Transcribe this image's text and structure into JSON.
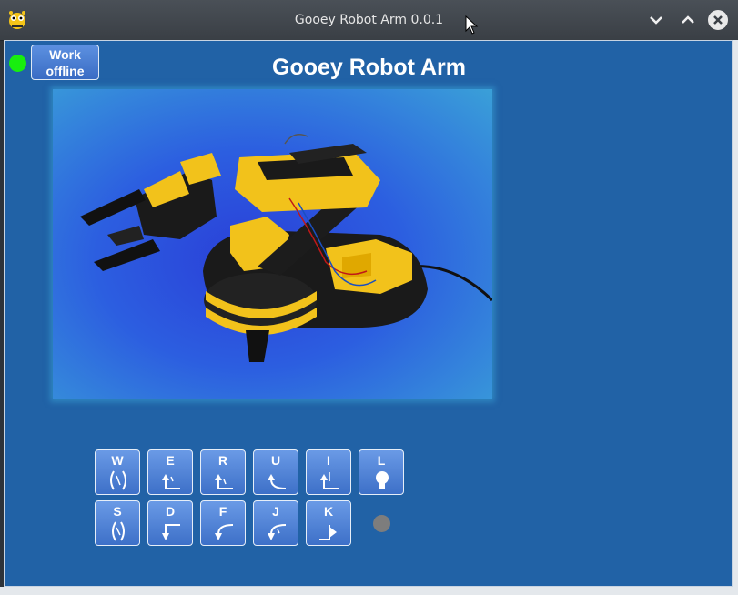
{
  "window": {
    "title": "Gooey Robot Arm 0.0.1",
    "icon": "pygame-snake-icon",
    "controls": [
      "minimize-icon",
      "maximize-icon",
      "close-icon"
    ]
  },
  "app": {
    "heading": "Gooey Robot Arm",
    "connection_status_color": "#18ee0f",
    "offline_button_label": "Work\noffline",
    "photo_description_icon": "robot-arm-photo"
  },
  "keys": {
    "row1": [
      {
        "letter": "W",
        "icon": "gripper-open-icon"
      },
      {
        "letter": "E",
        "icon": "wrist-up-icon"
      },
      {
        "letter": "R",
        "icon": "elbow-up-icon"
      },
      {
        "letter": "U",
        "icon": "shoulder-up-icon"
      },
      {
        "letter": "I",
        "icon": "base-left-icon"
      },
      {
        "letter": "L",
        "icon": "light-bulb-icon"
      }
    ],
    "row2": [
      {
        "letter": "S",
        "icon": "gripper-close-icon"
      },
      {
        "letter": "D",
        "icon": "wrist-down-icon"
      },
      {
        "letter": "F",
        "icon": "elbow-down-icon"
      },
      {
        "letter": "J",
        "icon": "shoulder-down-icon"
      },
      {
        "letter": "K",
        "icon": "base-right-icon"
      }
    ],
    "light_status_color": "#7d7d7d"
  },
  "colors": {
    "background": "#2162a6",
    "button": "#4a7ed4",
    "status_on": "#18ee0f",
    "status_off": "#7d7d7d"
  }
}
